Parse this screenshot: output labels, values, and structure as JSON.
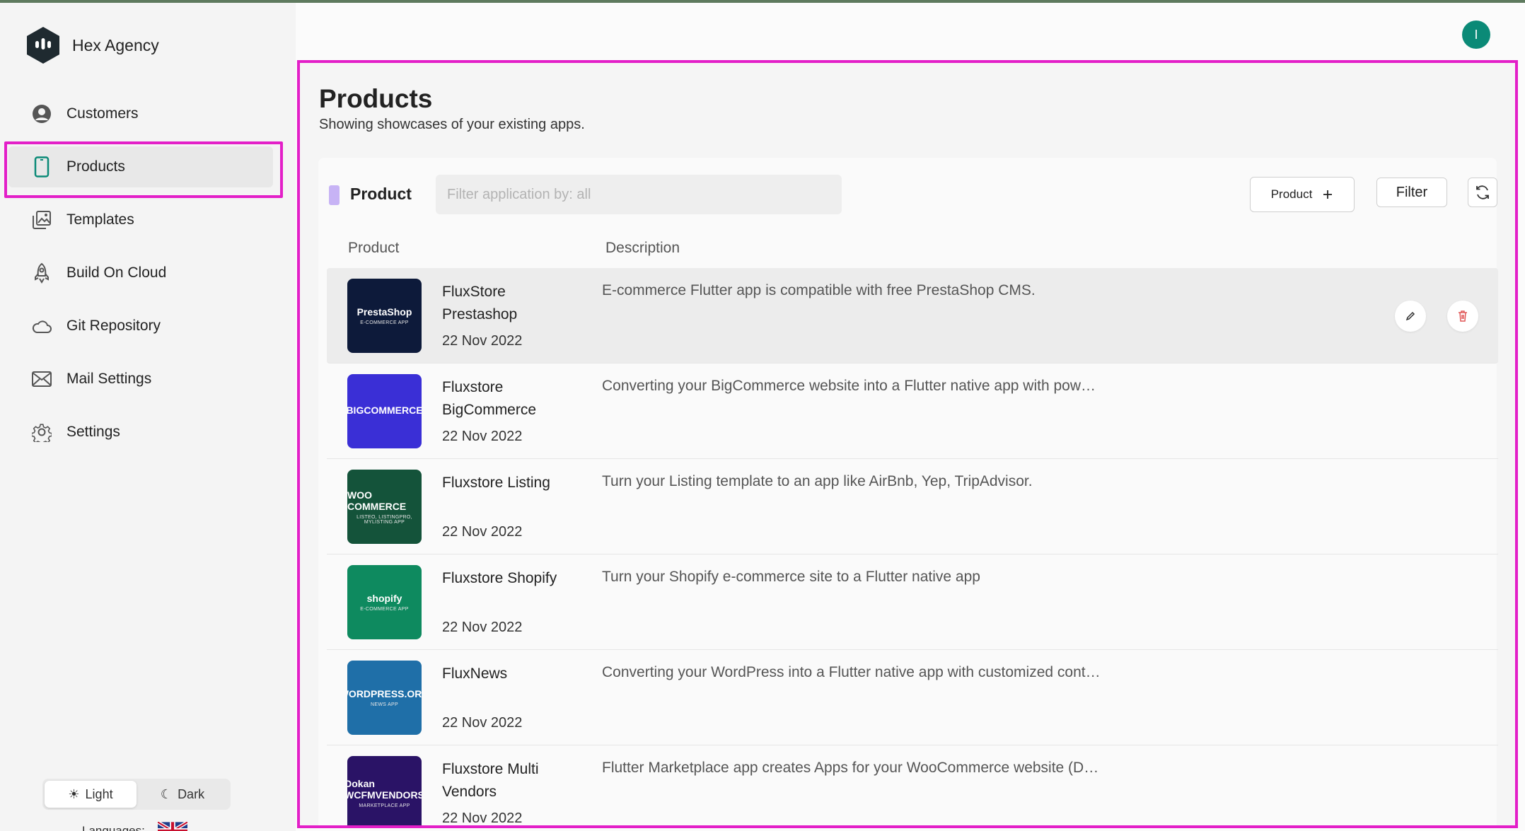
{
  "brand": {
    "name": "Hex Agency"
  },
  "sidebar": {
    "items": [
      {
        "label": "Customers",
        "icon": "user-circle-icon"
      },
      {
        "label": "Products",
        "icon": "phone-icon",
        "active": true
      },
      {
        "label": "Templates",
        "icon": "images-icon"
      },
      {
        "label": "Build On Cloud",
        "icon": "rocket-icon"
      },
      {
        "label": "Git Repository",
        "icon": "cloud-icon"
      },
      {
        "label": "Mail Settings",
        "icon": "mail-icon"
      },
      {
        "label": "Settings",
        "icon": "gear-icon"
      }
    ],
    "theme": {
      "light": "Light",
      "dark": "Dark"
    },
    "languages_label": "Languages:"
  },
  "header": {
    "avatar_initial": "I"
  },
  "page": {
    "title": "Products",
    "subtitle": "Showing showcases of your existing apps."
  },
  "toolbar": {
    "title": "Product",
    "filter_placeholder": "Filter application by: all",
    "add_product_label": "Product",
    "filter_label": "Filter"
  },
  "table": {
    "columns": {
      "product": "Product",
      "description": "Description"
    },
    "rows": [
      {
        "name": "FluxStore Prestashop",
        "date": "22 Nov 2022",
        "description": "E-commerce Flutter app is compatible with free PrestaShop CMS.",
        "thumb_brand": "PrestaShop",
        "thumb_sub": "E-COMMERCE APP",
        "thumb_color": "#0d1a3a"
      },
      {
        "name": "Fluxstore BigCommerce",
        "date": "22 Nov 2022",
        "description": "Converting your BigCommerce website into a Flutter native app with pow…",
        "thumb_brand": "BIGCOMMERCE",
        "thumb_sub": "",
        "thumb_color": "#3a2fd6"
      },
      {
        "name": "Fluxstore Listing",
        "date": "22 Nov 2022",
        "description": "Turn your Listing template to an app like AirBnb, Yep, TripAdvisor.",
        "thumb_brand": "WOO COMMERCE",
        "thumb_sub": "LISTEO, LISTINGPRO, MYLISTING APP",
        "thumb_color": "#14533a"
      },
      {
        "name": "Fluxstore Shopify",
        "date": "22 Nov 2022",
        "description": "Turn your Shopify e-commerce site to a Flutter native app",
        "thumb_brand": "shopify",
        "thumb_sub": "E-COMMERCE APP",
        "thumb_color": "#0e8a5f"
      },
      {
        "name": "FluxNews",
        "date": "22 Nov 2022",
        "description": "Converting your WordPress into a Flutter native app with customized cont…",
        "thumb_brand": "WORDPRESS.ORG",
        "thumb_sub": "NEWS APP",
        "thumb_color": "#1f6fa8"
      },
      {
        "name": "Fluxstore Multi Vendors",
        "date": "22 Nov 2022",
        "description": "Flutter Marketplace app creates Apps for your WooCommerce website (D…",
        "thumb_brand": "Dokan WCFMVENDORS",
        "thumb_sub": "MARKETPLACE APP",
        "thumb_color": "#2a1366"
      }
    ]
  },
  "colors": {
    "accent": "#0b8a77",
    "highlight": "#e31fc8"
  }
}
